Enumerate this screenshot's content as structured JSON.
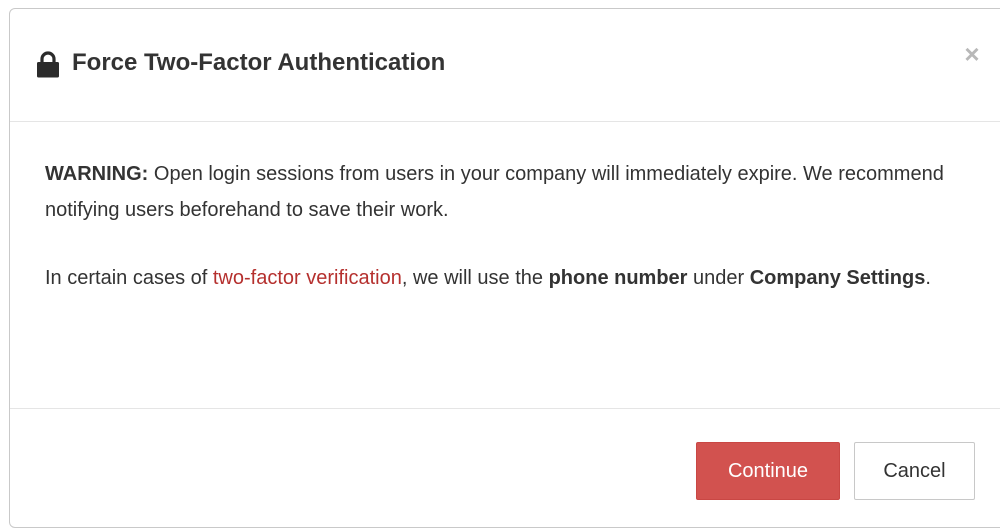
{
  "dialog": {
    "title": "Force Two-Factor Authentication",
    "title_icon": "lock-icon",
    "close_label": "×"
  },
  "body": {
    "warning_label": "WARNING:",
    "warning_text": " Open login sessions from users in your company will immediately expire. We recommend notifying users beforehand to save their work.",
    "info_prefix": "In certain cases of ",
    "info_link": "two-factor verification",
    "info_middle": ", we will use the ",
    "info_bold_phone": "phone number",
    "info_after_phone": " under ",
    "info_bold_settings": "Company Settings",
    "info_end": "."
  },
  "footer": {
    "continue_label": "Continue",
    "cancel_label": "Cancel"
  },
  "colors": {
    "primary": "#d2524f",
    "link": "#b5302e",
    "text": "#333333"
  }
}
